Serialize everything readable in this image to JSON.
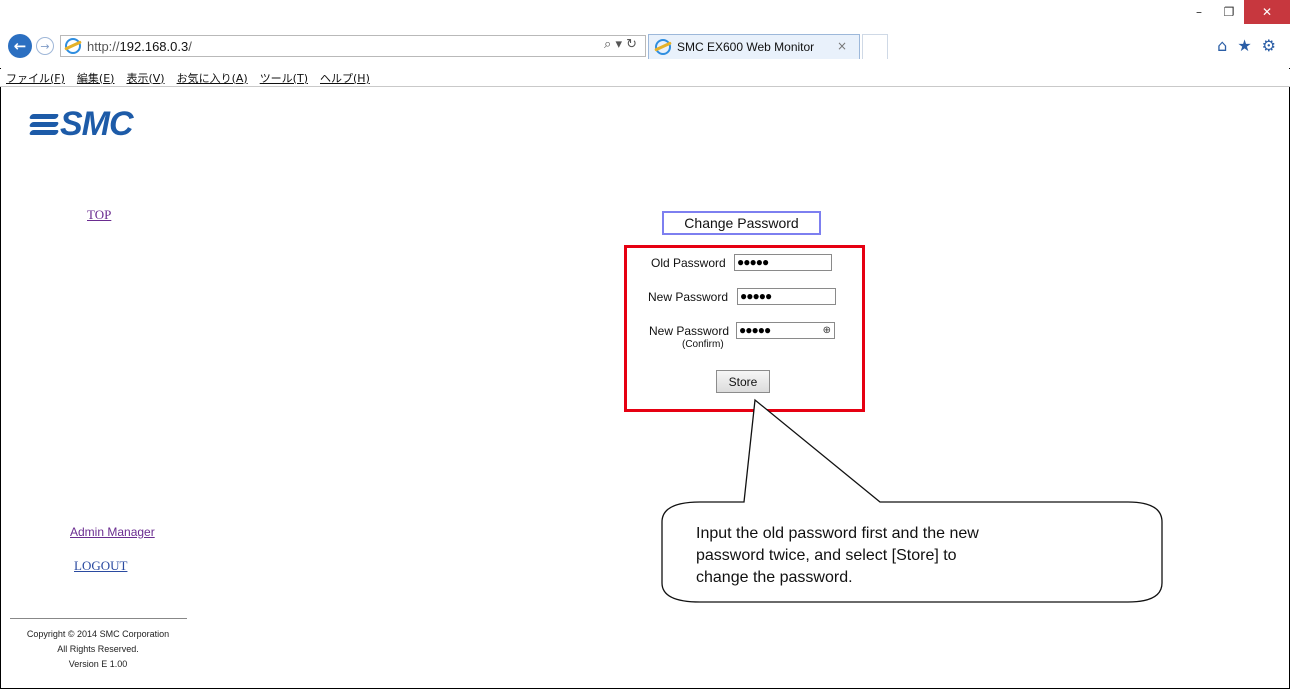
{
  "browser": {
    "window_controls": {
      "minimize": "–",
      "restore": "❐",
      "close": "✕"
    },
    "back_symbol": "←",
    "forward_symbol": "→",
    "address": {
      "scheme": "http://",
      "host": "192.168.0.3",
      "path": "/"
    },
    "address_icons": "⌕ ▾ ↻",
    "tab": {
      "title": "SMC EX600 Web Monitor",
      "close": "×"
    },
    "right_icons": [
      "home-icon",
      "favorites-star-icon",
      "settings-gear-icon"
    ],
    "right_glyphs": {
      "home": "⌂",
      "star": "★",
      "gear": "⚙"
    },
    "menu": [
      "ファイル(F)",
      "編集(E)",
      "表示(V)",
      "お気に入り(A)",
      "ツール(T)",
      "ヘルプ(H)"
    ]
  },
  "sidebar": {
    "logo_text": "SMC",
    "top_link": "TOP",
    "admin_link": "Admin Manager",
    "logout_link": "LOGOUT",
    "copyright_lines": [
      "Copyright © 2014 SMC Corporation",
      "All Rights Reserved.",
      "Version E 1.00"
    ]
  },
  "main": {
    "title": "Change Password",
    "fields": [
      {
        "label": "Old Password",
        "value": "●●●●●"
      },
      {
        "label": "New Password",
        "value": "●●●●●"
      },
      {
        "label": "New Password",
        "sublabel": "(Confirm)",
        "value": "●●●●●"
      }
    ],
    "store_button": "Store"
  },
  "callout": {
    "lines": [
      "Input the old password first and the new",
      "password twice, and select [Store] to",
      "change the password."
    ]
  },
  "colors": {
    "highlight_box": "#e60012",
    "title_border": "#7d7ff0",
    "logo": "#1d5ba8",
    "link_visited": "#6a2c90"
  }
}
